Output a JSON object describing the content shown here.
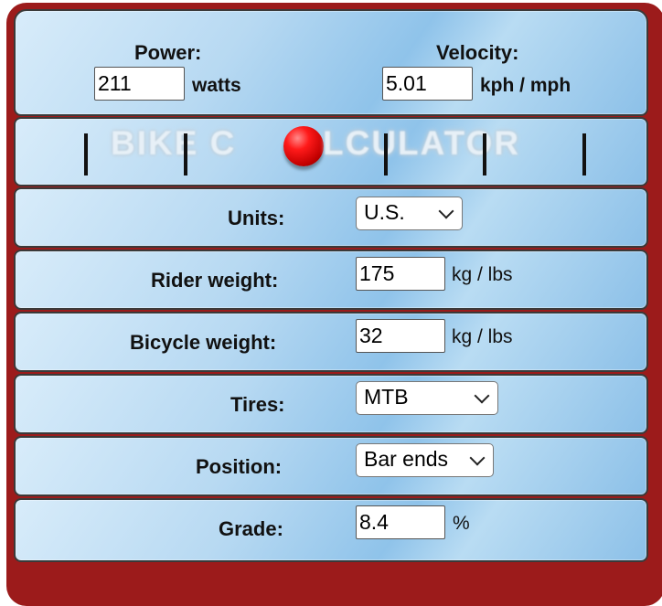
{
  "top": {
    "power_label": "Power:",
    "power_value": "211",
    "power_unit": "watts",
    "velocity_label": "Velocity:",
    "velocity_value": "5.01",
    "velocity_unit": "kph / mph"
  },
  "banner": {
    "text_left": "BIKE C",
    "text_right": "LCULATOR"
  },
  "rows": {
    "units": {
      "label": "Units:",
      "value": "U.S."
    },
    "rider_weight": {
      "label": "Rider weight:",
      "value": "175",
      "unit": "kg / lbs"
    },
    "bicycle_weight": {
      "label": "Bicycle weight:",
      "value": "32",
      "unit": "kg / lbs"
    },
    "tires": {
      "label": "Tires:",
      "value": "MTB"
    },
    "position": {
      "label": "Position:",
      "value": "Bar ends"
    },
    "grade": {
      "label": "Grade:",
      "value": "8.4",
      "unit": "%"
    }
  },
  "colors": {
    "frame": "#9c1b1b",
    "panel_light": "#d8ecfa",
    "panel_mid": "#8fc3ea",
    "ball": "#ff1a1a"
  },
  "icons": {
    "select_arrow": "chevron-down-icon",
    "logo_ball": "red-ball-icon"
  }
}
